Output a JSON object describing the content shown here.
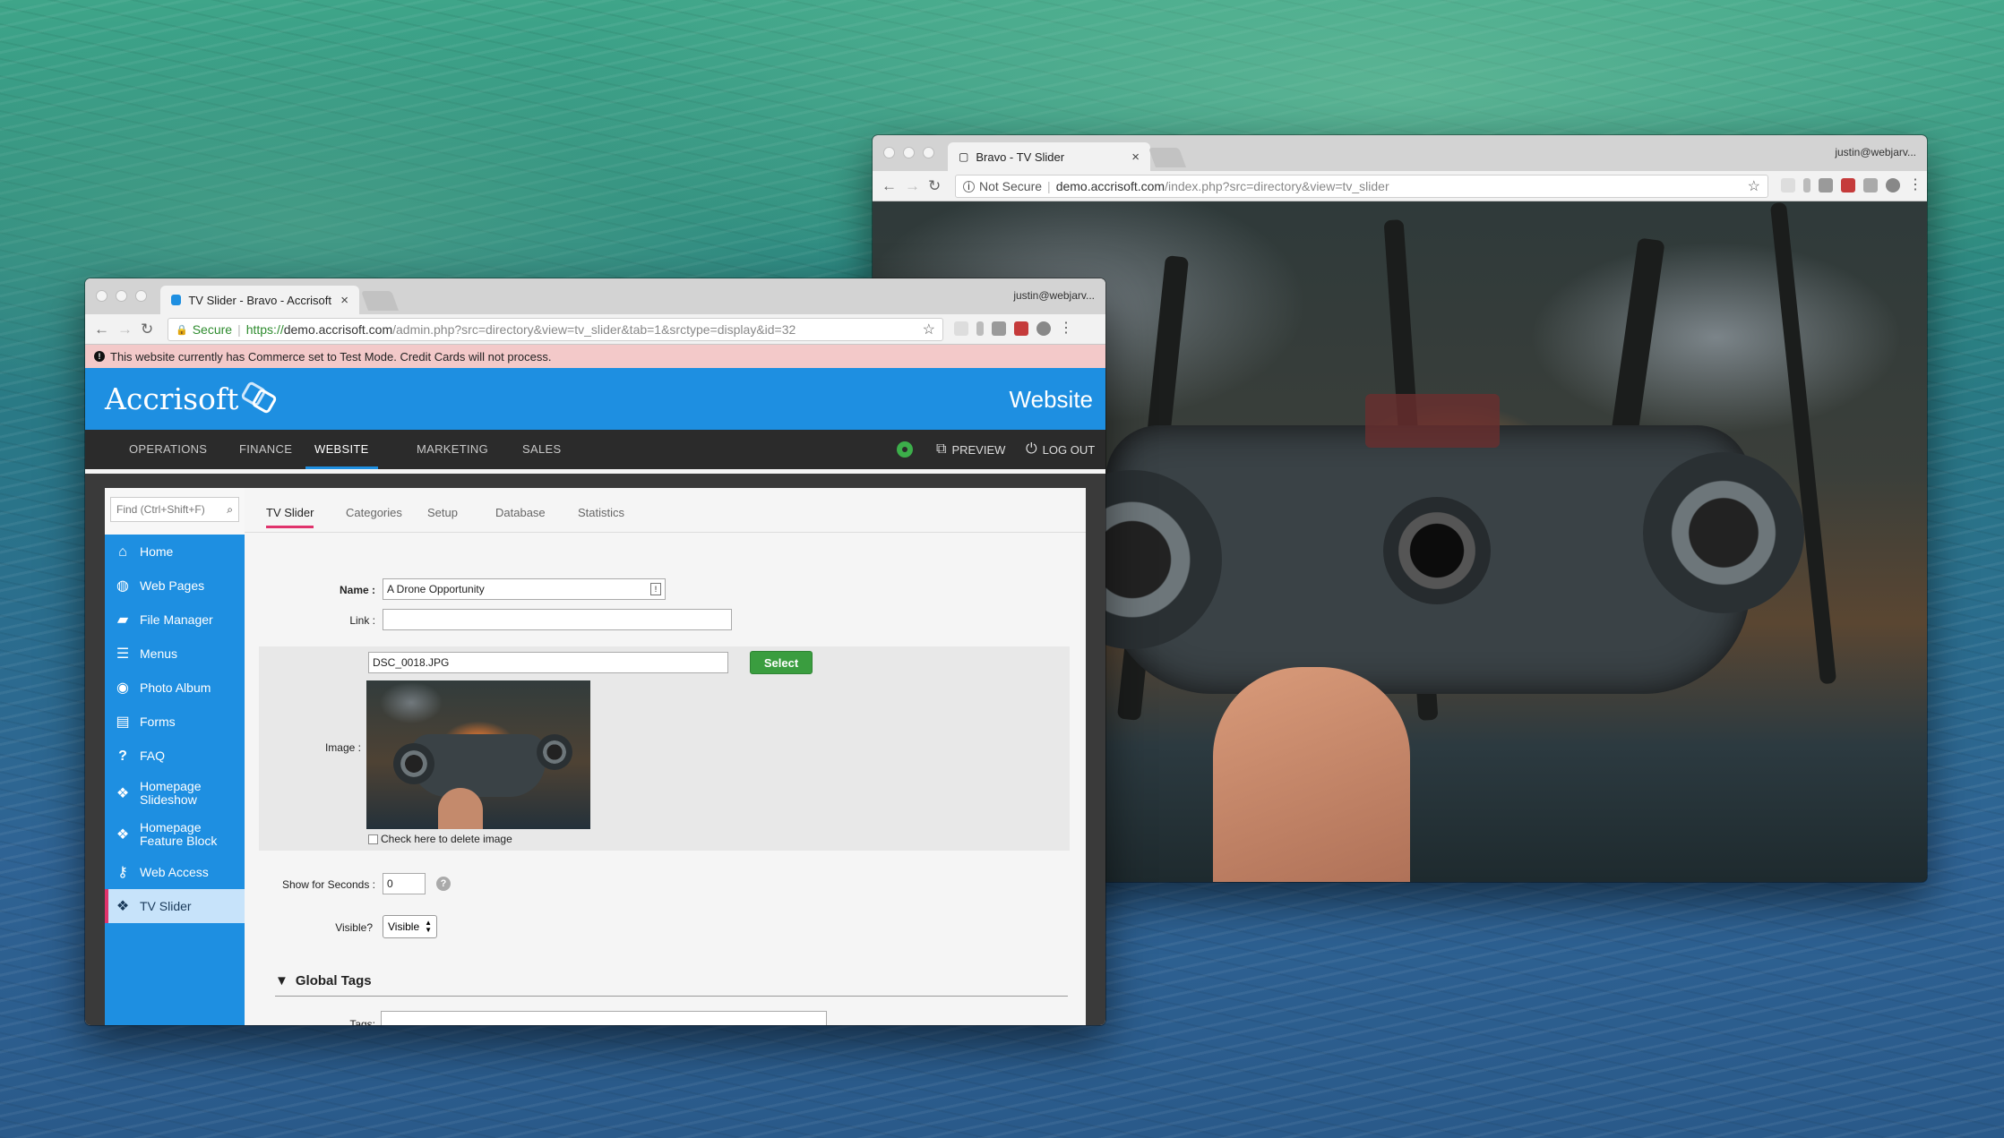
{
  "back_window": {
    "tab_title": "Bravo - TV Slider",
    "tab_close": "×",
    "user": "justin@webjarv...",
    "omnibox": {
      "security": "Not Secure",
      "url_domain": "demo.accrisoft.com",
      "url_path": "/index.php?src=directory&view=tv_slider"
    }
  },
  "front_window": {
    "tab_title": "TV Slider - Bravo - Accrisoft F",
    "tab_close": "×",
    "user": "justin@webjarv...",
    "omnibox": {
      "security": "Secure",
      "url_scheme": "https://",
      "url_domain": "demo.accrisoft.com",
      "url_path": "/admin.php?src=directory&view=tv_slider&tab=1&srctype=display&id=32"
    },
    "alert": "This website currently has Commerce set to Test Mode. Credit Cards will not process.",
    "header": {
      "logo": "Accrisoft",
      "title": "Website"
    },
    "topnav": {
      "items": [
        "OPERATIONS",
        "FINANCE",
        "WEBSITE",
        "MARKETING",
        "SALES"
      ],
      "active": "WEBSITE",
      "preview": "PREVIEW",
      "logout": "LOG OUT"
    },
    "sidebar": {
      "search_placeholder": "Find (Ctrl+Shift+F)",
      "items": [
        {
          "label": "Home",
          "icon": "home-icon"
        },
        {
          "label": "Web Pages",
          "icon": "globe-icon"
        },
        {
          "label": "File Manager",
          "icon": "folder-icon"
        },
        {
          "label": "Menus",
          "icon": "menu-icon"
        },
        {
          "label": "Photo Album",
          "icon": "camera-icon"
        },
        {
          "label": "Forms",
          "icon": "clipboard-icon"
        },
        {
          "label": "FAQ",
          "icon": "question-icon"
        },
        {
          "label": "Homepage Slideshow",
          "icon": "cubes-icon"
        },
        {
          "label": "Homepage Feature Block",
          "icon": "cubes-icon"
        },
        {
          "label": "Web Access",
          "icon": "key-icon"
        },
        {
          "label": "TV Slider",
          "icon": "cubes-icon"
        }
      ],
      "active": "TV Slider"
    },
    "content_tabs": [
      "TV Slider",
      "Categories",
      "Setup",
      "Database",
      "Statistics"
    ],
    "form": {
      "name_label": "Name :",
      "name_value": "A Drone Opportunity",
      "link_label": "Link :",
      "link_value": "",
      "image_label": "Image :",
      "image_file": "DSC_0018.JPG",
      "select_button": "Select",
      "delete_image": "Check here to delete image",
      "seconds_label": "Show for Seconds :",
      "seconds_value": "0",
      "help": "?",
      "visible_label": "Visible?",
      "visible_value": "Visible",
      "section_title": "Global Tags",
      "tags_label": "Tags:",
      "tags_value": ""
    }
  }
}
